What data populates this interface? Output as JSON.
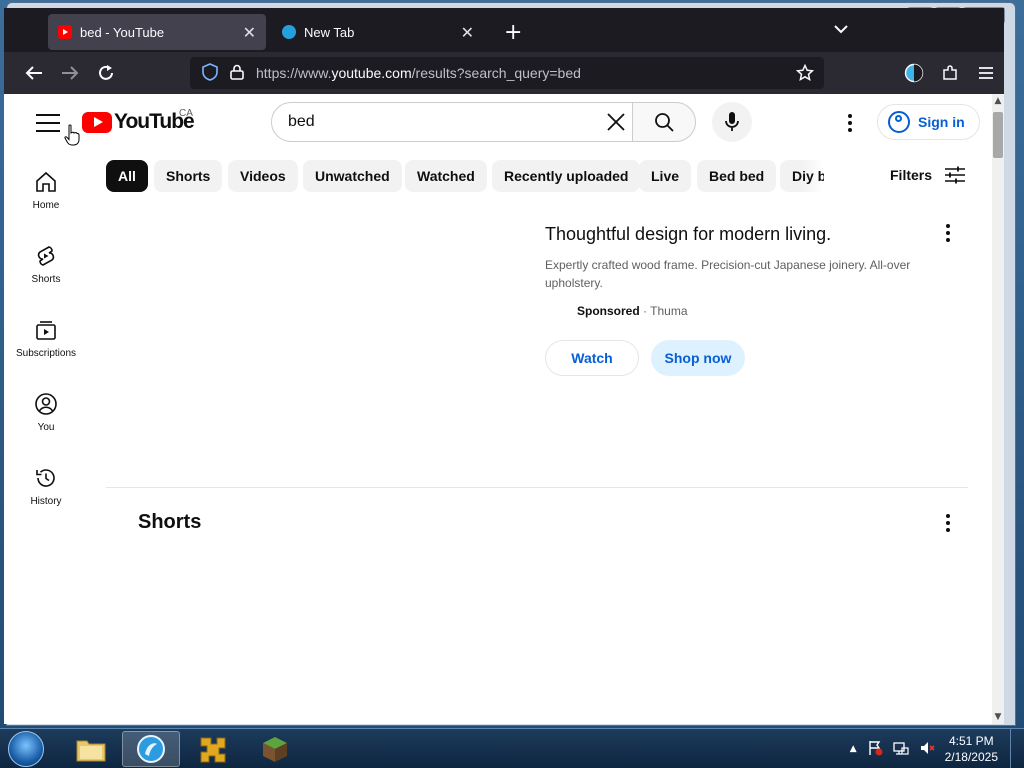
{
  "browser": {
    "tabs": [
      {
        "title": "bed - YouTube",
        "active": true,
        "favicon": "youtube-icon"
      },
      {
        "title": "New Tab",
        "active": false,
        "favicon": "edge-icon"
      }
    ],
    "url_prefix": "https://www.",
    "url_host": "youtube.com",
    "url_path": "/results?search_query=bed"
  },
  "masthead": {
    "logo_text": "YouTube",
    "region": "CA",
    "search_value": "bed",
    "signin_label": "Sign in"
  },
  "guide": {
    "items": [
      {
        "label": "Home",
        "icon": "home-icon"
      },
      {
        "label": "Shorts",
        "icon": "shorts-icon"
      },
      {
        "label": "Subscriptions",
        "icon": "subscriptions-icon"
      },
      {
        "label": "You",
        "icon": "you-icon"
      },
      {
        "label": "History",
        "icon": "history-icon"
      }
    ]
  },
  "chips": [
    "All",
    "Shorts",
    "Videos",
    "Unwatched",
    "Watched",
    "Recently uploaded",
    "Live",
    "Bed bed",
    "Diy b"
  ],
  "filters_label": "Filters",
  "ad": {
    "title": "Thoughtful design for modern living.",
    "description": "Expertly crafted wood frame. Precision-cut Japanese joinery. All-over upholstery.",
    "sponsored_label": "Sponsored",
    "separator": "·",
    "advertiser": "Thuma",
    "watch_label": "Watch",
    "shop_label": "Shop now"
  },
  "shorts_section": {
    "heading": "Shorts"
  },
  "taskbar": {
    "time": "4:51 PM",
    "date": "2/18/2025"
  },
  "colors": {
    "youtube_red": "#ff0000",
    "link_blue": "#065fd4",
    "browser_dark": "#1c1b22"
  }
}
